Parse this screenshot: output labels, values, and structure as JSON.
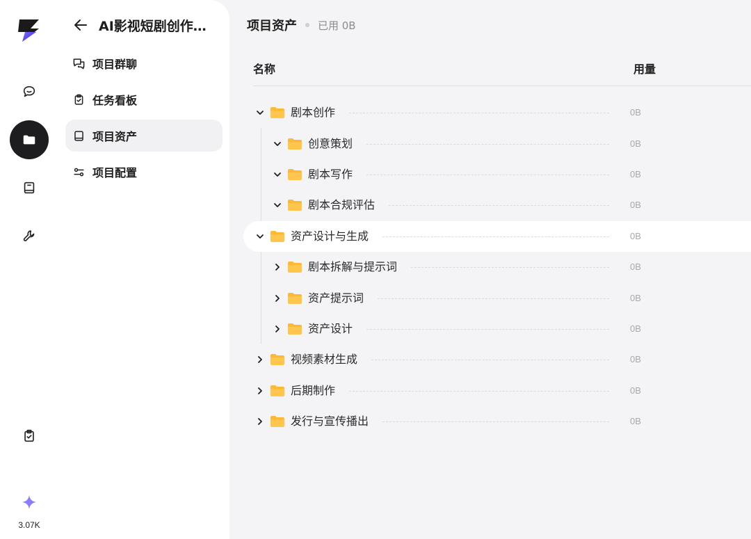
{
  "rail": {
    "items": [
      {
        "name": "chat-icon",
        "active": false
      },
      {
        "name": "folder-icon",
        "active": true
      },
      {
        "name": "book-icon",
        "active": false
      },
      {
        "name": "wrench-icon",
        "active": false
      },
      {
        "name": "clipboard-icon",
        "active": false
      }
    ],
    "credits": "3.07K"
  },
  "side": {
    "project_title": "AI影视短剧创作…",
    "nav": [
      {
        "label": "项目群聊",
        "icon": "group-chat-icon"
      },
      {
        "label": "任务看板",
        "icon": "task-board-icon"
      },
      {
        "label": "项目资产",
        "icon": "assets-icon",
        "active": true
      },
      {
        "label": "项目配置",
        "icon": "settings-sliders-icon"
      }
    ]
  },
  "main": {
    "title": "项目资产",
    "used": "已用 0B",
    "columns": {
      "name": "名称",
      "usage": "用量"
    },
    "rows": [
      {
        "name": "剧本创作",
        "size": "0B",
        "level": 0,
        "expanded": true
      },
      {
        "name": "创意策划",
        "size": "0B",
        "level": 1,
        "expanded": true
      },
      {
        "name": "剧本写作",
        "size": "0B",
        "level": 1,
        "expanded": true
      },
      {
        "name": "剧本合规评估",
        "size": "0B",
        "level": 1,
        "expanded": true
      },
      {
        "name": "资产设计与生成",
        "size": "0B",
        "level": 0,
        "expanded": true,
        "hover": true
      },
      {
        "name": "剧本拆解与提示词",
        "size": "0B",
        "level": 1,
        "expanded": false
      },
      {
        "name": "资产提示词",
        "size": "0B",
        "level": 1,
        "expanded": false
      },
      {
        "name": "资产设计",
        "size": "0B",
        "level": 1,
        "expanded": false
      },
      {
        "name": "视频素材生成",
        "size": "0B",
        "level": 0,
        "expanded": false
      },
      {
        "name": "后期制作",
        "size": "0B",
        "level": 0,
        "expanded": false
      },
      {
        "name": "发行与宣传播出",
        "size": "0B",
        "level": 0,
        "expanded": false
      }
    ]
  },
  "colors": {
    "accent": "#1d1d1f",
    "folder": "#ffb833",
    "logo_purple": "#5b4cf0"
  }
}
